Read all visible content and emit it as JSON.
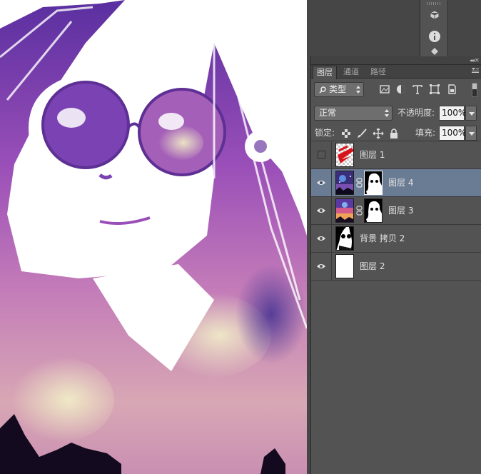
{
  "colors": {
    "panel_bg": "#535353",
    "tab_bar": "#424242",
    "workspace": "#464646",
    "selected_layer": "#6a7b94",
    "canvas_bg": "#ffffff"
  },
  "dock": {
    "icons": [
      "3d-cube-icon",
      "info-icon",
      "adjust-icon"
    ]
  },
  "panel": {
    "tabs": [
      {
        "label": "图层",
        "active": true
      },
      {
        "label": "通道",
        "active": false
      },
      {
        "label": "路径",
        "active": false
      }
    ],
    "filter": {
      "kind_label": "类型",
      "filter_icons": [
        "pixel-filter-icon",
        "adjustment-filter-icon",
        "type-filter-icon",
        "shape-filter-icon",
        "smart-object-filter-icon"
      ]
    },
    "blend": {
      "mode": "正常",
      "opacity_label": "不透明度:",
      "opacity_value": "100%"
    },
    "lock": {
      "label": "锁定:",
      "lock_icons": [
        "lock-transparent-icon",
        "lock-paint-icon",
        "lock-move-icon",
        "lock-all-icon"
      ],
      "fill_label": "填充:",
      "fill_value": "100%"
    },
    "layers": [
      {
        "name": "图层 1",
        "visible": false,
        "selected": false,
        "has_mask": false,
        "thumb": "red-brush"
      },
      {
        "name": "图层 4",
        "visible": true,
        "selected": true,
        "has_mask": true,
        "thumb": "galaxy-dark"
      },
      {
        "name": "图层 3",
        "visible": true,
        "selected": false,
        "has_mask": true,
        "thumb": "galaxy-warm"
      },
      {
        "name": "背景 拷贝 2",
        "visible": true,
        "selected": false,
        "has_mask": false,
        "thumb": "bw-portrait"
      },
      {
        "name": "图层 2",
        "visible": true,
        "selected": false,
        "has_mask": false,
        "thumb": "white"
      }
    ]
  }
}
